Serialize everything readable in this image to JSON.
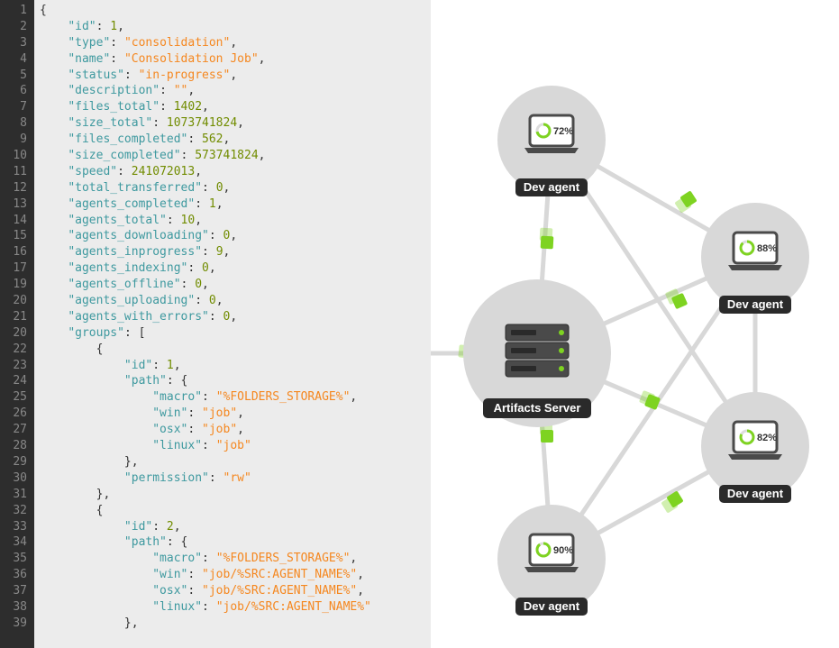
{
  "code": {
    "line_numbers": [
      "1",
      "2",
      "3",
      "4",
      "5",
      "6",
      "7",
      "8",
      "9",
      "10",
      "11",
      "12",
      "13",
      "14",
      "15",
      "16",
      "17",
      "19",
      "20",
      "21",
      "20",
      "22",
      "23",
      "24",
      "25",
      "26",
      "27",
      "28",
      "29",
      "30",
      "31",
      "32",
      "33",
      "34",
      "35",
      "36",
      "37",
      "38",
      "39"
    ],
    "tokens": [
      [
        {
          "t": "{",
          "c": "pun"
        }
      ],
      [
        {
          "t": "    ",
          "c": "pun"
        },
        {
          "t": "\"id\"",
          "c": "key"
        },
        {
          "t": ": ",
          "c": "pun"
        },
        {
          "t": "1",
          "c": "num"
        },
        {
          "t": ",",
          "c": "pun"
        }
      ],
      [
        {
          "t": "    ",
          "c": "pun"
        },
        {
          "t": "\"type\"",
          "c": "key"
        },
        {
          "t": ": ",
          "c": "pun"
        },
        {
          "t": "\"consolidation\"",
          "c": "str"
        },
        {
          "t": ",",
          "c": "pun"
        }
      ],
      [
        {
          "t": "    ",
          "c": "pun"
        },
        {
          "t": "\"name\"",
          "c": "key"
        },
        {
          "t": ": ",
          "c": "pun"
        },
        {
          "t": "\"Consolidation Job\"",
          "c": "str"
        },
        {
          "t": ",",
          "c": "pun"
        }
      ],
      [
        {
          "t": "    ",
          "c": "pun"
        },
        {
          "t": "\"status\"",
          "c": "key"
        },
        {
          "t": ": ",
          "c": "pun"
        },
        {
          "t": "\"in-progress\"",
          "c": "str"
        },
        {
          "t": ",",
          "c": "pun"
        }
      ],
      [
        {
          "t": "    ",
          "c": "pun"
        },
        {
          "t": "\"description\"",
          "c": "key"
        },
        {
          "t": ": ",
          "c": "pun"
        },
        {
          "t": "\"\"",
          "c": "str"
        },
        {
          "t": ",",
          "c": "pun"
        }
      ],
      [
        {
          "t": "    ",
          "c": "pun"
        },
        {
          "t": "\"files_total\"",
          "c": "key"
        },
        {
          "t": ": ",
          "c": "pun"
        },
        {
          "t": "1402",
          "c": "num"
        },
        {
          "t": ",",
          "c": "pun"
        }
      ],
      [
        {
          "t": "    ",
          "c": "pun"
        },
        {
          "t": "\"size_total\"",
          "c": "key"
        },
        {
          "t": ": ",
          "c": "pun"
        },
        {
          "t": "1073741824",
          "c": "num"
        },
        {
          "t": ",",
          "c": "pun"
        }
      ],
      [
        {
          "t": "    ",
          "c": "pun"
        },
        {
          "t": "\"files_completed\"",
          "c": "key"
        },
        {
          "t": ": ",
          "c": "pun"
        },
        {
          "t": "562",
          "c": "num"
        },
        {
          "t": ",",
          "c": "pun"
        }
      ],
      [
        {
          "t": "    ",
          "c": "pun"
        },
        {
          "t": "\"size_completed\"",
          "c": "key"
        },
        {
          "t": ": ",
          "c": "pun"
        },
        {
          "t": "573741824",
          "c": "num"
        },
        {
          "t": ",",
          "c": "pun"
        }
      ],
      [
        {
          "t": "    ",
          "c": "pun"
        },
        {
          "t": "\"speed\"",
          "c": "key"
        },
        {
          "t": ": ",
          "c": "pun"
        },
        {
          "t": "241072013",
          "c": "num"
        },
        {
          "t": ",",
          "c": "pun"
        }
      ],
      [
        {
          "t": "    ",
          "c": "pun"
        },
        {
          "t": "\"total_transferred\"",
          "c": "key"
        },
        {
          "t": ": ",
          "c": "pun"
        },
        {
          "t": "0",
          "c": "num"
        },
        {
          "t": ",",
          "c": "pun"
        }
      ],
      [
        {
          "t": "    ",
          "c": "pun"
        },
        {
          "t": "\"agents_completed\"",
          "c": "key"
        },
        {
          "t": ": ",
          "c": "pun"
        },
        {
          "t": "1",
          "c": "num"
        },
        {
          "t": ",",
          "c": "pun"
        }
      ],
      [
        {
          "t": "    ",
          "c": "pun"
        },
        {
          "t": "\"agents_total\"",
          "c": "key"
        },
        {
          "t": ": ",
          "c": "pun"
        },
        {
          "t": "10",
          "c": "num"
        },
        {
          "t": ",",
          "c": "pun"
        }
      ],
      [
        {
          "t": "    ",
          "c": "pun"
        },
        {
          "t": "\"agents_downloading\"",
          "c": "key"
        },
        {
          "t": ": ",
          "c": "pun"
        },
        {
          "t": "0",
          "c": "num"
        },
        {
          "t": ",",
          "c": "pun"
        }
      ],
      [
        {
          "t": "    ",
          "c": "pun"
        },
        {
          "t": "\"agents_inprogress\"",
          "c": "key"
        },
        {
          "t": ": ",
          "c": "pun"
        },
        {
          "t": "9",
          "c": "num"
        },
        {
          "t": ",",
          "c": "pun"
        }
      ],
      [
        {
          "t": "    ",
          "c": "pun"
        },
        {
          "t": "\"agents_indexing\"",
          "c": "key"
        },
        {
          "t": ": ",
          "c": "pun"
        },
        {
          "t": "0",
          "c": "num"
        },
        {
          "t": ",",
          "c": "pun"
        }
      ],
      [
        {
          "t": "    ",
          "c": "pun"
        },
        {
          "t": "\"agents_offline\"",
          "c": "key"
        },
        {
          "t": ": ",
          "c": "pun"
        },
        {
          "t": "0",
          "c": "num"
        },
        {
          "t": ",",
          "c": "pun"
        }
      ],
      [
        {
          "t": "    ",
          "c": "pun"
        },
        {
          "t": "\"agents_uploading\"",
          "c": "key"
        },
        {
          "t": ": ",
          "c": "pun"
        },
        {
          "t": "0",
          "c": "num"
        },
        {
          "t": ",",
          "c": "pun"
        }
      ],
      [
        {
          "t": "    ",
          "c": "pun"
        },
        {
          "t": "\"agents_with_errors\"",
          "c": "key"
        },
        {
          "t": ": ",
          "c": "pun"
        },
        {
          "t": "0",
          "c": "num"
        },
        {
          "t": ",",
          "c": "pun"
        }
      ],
      [
        {
          "t": "    ",
          "c": "pun"
        },
        {
          "t": "\"groups\"",
          "c": "key"
        },
        {
          "t": ": [",
          "c": "pun"
        }
      ],
      [
        {
          "t": "        {",
          "c": "pun"
        }
      ],
      [
        {
          "t": "            ",
          "c": "pun"
        },
        {
          "t": "\"id\"",
          "c": "key"
        },
        {
          "t": ": ",
          "c": "pun"
        },
        {
          "t": "1",
          "c": "num"
        },
        {
          "t": ",",
          "c": "pun"
        }
      ],
      [
        {
          "t": "            ",
          "c": "pun"
        },
        {
          "t": "\"path\"",
          "c": "key"
        },
        {
          "t": ": {",
          "c": "pun"
        }
      ],
      [
        {
          "t": "                ",
          "c": "pun"
        },
        {
          "t": "\"macro\"",
          "c": "key"
        },
        {
          "t": ": ",
          "c": "pun"
        },
        {
          "t": "\"%FOLDERS_STORAGE%\"",
          "c": "str"
        },
        {
          "t": ",",
          "c": "pun"
        }
      ],
      [
        {
          "t": "                ",
          "c": "pun"
        },
        {
          "t": "\"win\"",
          "c": "key"
        },
        {
          "t": ": ",
          "c": "pun"
        },
        {
          "t": "\"job\"",
          "c": "str"
        },
        {
          "t": ",",
          "c": "pun"
        }
      ],
      [
        {
          "t": "                ",
          "c": "pun"
        },
        {
          "t": "\"osx\"",
          "c": "key"
        },
        {
          "t": ": ",
          "c": "pun"
        },
        {
          "t": "\"job\"",
          "c": "str"
        },
        {
          "t": ",",
          "c": "pun"
        }
      ],
      [
        {
          "t": "                ",
          "c": "pun"
        },
        {
          "t": "\"linux\"",
          "c": "key"
        },
        {
          "t": ": ",
          "c": "pun"
        },
        {
          "t": "\"job\"",
          "c": "str"
        }
      ],
      [
        {
          "t": "            },",
          "c": "pun"
        }
      ],
      [
        {
          "t": "            ",
          "c": "pun"
        },
        {
          "t": "\"permission\"",
          "c": "key"
        },
        {
          "t": ": ",
          "c": "pun"
        },
        {
          "t": "\"rw\"",
          "c": "str"
        }
      ],
      [
        {
          "t": "        },",
          "c": "pun"
        }
      ],
      [
        {
          "t": "        {",
          "c": "pun"
        }
      ],
      [
        {
          "t": "            ",
          "c": "pun"
        },
        {
          "t": "\"id\"",
          "c": "key"
        },
        {
          "t": ": ",
          "c": "pun"
        },
        {
          "t": "2",
          "c": "num"
        },
        {
          "t": ",",
          "c": "pun"
        }
      ],
      [
        {
          "t": "            ",
          "c": "pun"
        },
        {
          "t": "\"path\"",
          "c": "key"
        },
        {
          "t": ": {",
          "c": "pun"
        }
      ],
      [
        {
          "t": "                ",
          "c": "pun"
        },
        {
          "t": "\"macro\"",
          "c": "key"
        },
        {
          "t": ": ",
          "c": "pun"
        },
        {
          "t": "\"%FOLDERS_STORAGE%\"",
          "c": "str"
        },
        {
          "t": ",",
          "c": "pun"
        }
      ],
      [
        {
          "t": "                ",
          "c": "pun"
        },
        {
          "t": "\"win\"",
          "c": "key"
        },
        {
          "t": ": ",
          "c": "pun"
        },
        {
          "t": "\"job/%SRC:AGENT_NAME%\"",
          "c": "str"
        },
        {
          "t": ",",
          "c": "pun"
        }
      ],
      [
        {
          "t": "                ",
          "c": "pun"
        },
        {
          "t": "\"osx\"",
          "c": "key"
        },
        {
          "t": ": ",
          "c": "pun"
        },
        {
          "t": "\"job/%SRC:AGENT_NAME%\"",
          "c": "str"
        },
        {
          "t": ",",
          "c": "pun"
        }
      ],
      [
        {
          "t": "                ",
          "c": "pun"
        },
        {
          "t": "\"linux\"",
          "c": "key"
        },
        {
          "t": ": ",
          "c": "pun"
        },
        {
          "t": "\"job/%SRC:AGENT_NAME%\"",
          "c": "str"
        }
      ],
      [
        {
          "t": "            },",
          "c": "pun"
        }
      ]
    ]
  },
  "diagram": {
    "server_label": "Artifacts Server",
    "agents": [
      {
        "label": "Dev agent",
        "pct": "72%"
      },
      {
        "label": "Dev agent",
        "pct": "88%"
      },
      {
        "label": "Dev agent",
        "pct": "82%"
      },
      {
        "label": "Dev agent",
        "pct": "90%"
      }
    ]
  }
}
